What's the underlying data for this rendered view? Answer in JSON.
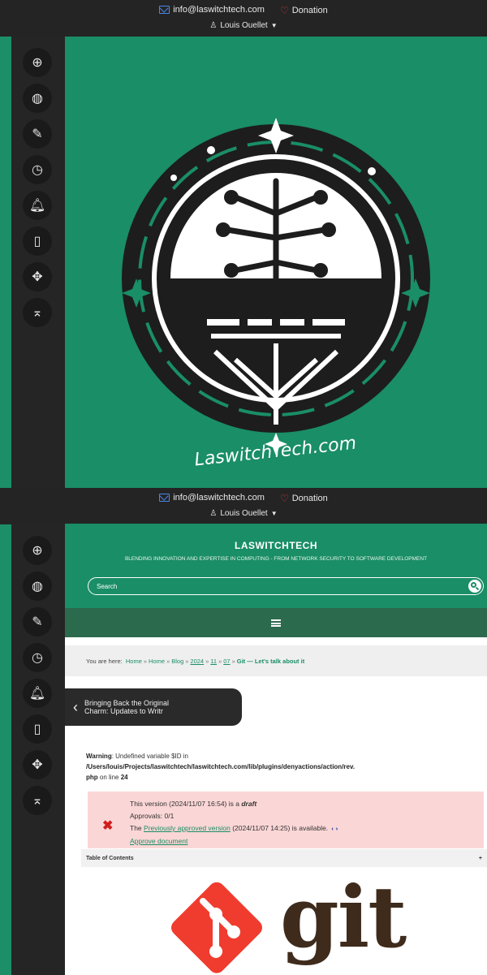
{
  "topbar": {
    "email": "info@laswitchtech.com",
    "donation": "Donation",
    "user": "Louis Ouellet"
  },
  "sidebar": {
    "buttons": [
      {
        "icon": "add-icon",
        "glyph": "⊕"
      },
      {
        "icon": "globe-icon",
        "glyph": "◍"
      },
      {
        "icon": "edit-icon",
        "glyph": "✎"
      },
      {
        "icon": "history-icon",
        "glyph": "◷"
      },
      {
        "icon": "bell-icon",
        "glyph": "♫"
      },
      {
        "icon": "pdf-icon",
        "glyph": "▯"
      },
      {
        "icon": "move-icon",
        "glyph": "✥"
      },
      {
        "icon": "back-to-top-icon",
        "glyph": "⌅"
      }
    ]
  },
  "logo": {
    "text": "LaswitchTech.com"
  },
  "site": {
    "title": "LASWITCHTECH",
    "tagline": "BLENDING INNOVATION AND EXPERTISE IN COMPUTING - FROM NETWORK SECURITY TO SOFTWARE DEVELOPMENT",
    "search_placeholder": "Search"
  },
  "breadcrumb": {
    "prefix": "You are here:",
    "items": [
      "Home",
      "Home",
      "Blog",
      "2024",
      "11",
      "07"
    ],
    "current": "Git — Let's talk about it"
  },
  "prev_page": {
    "label_line1": "Bringing Back the Original",
    "label_line2": "Charm: Updates to Writr"
  },
  "warning": {
    "label": "Warning",
    "message": ": Undefined variable $ID in",
    "path": "/Users/louis/Projects/laswitchtech/laswitchtech.com/lib/plugins/denyactions/action/rev.",
    "path_end": "php",
    "on_line": "on line",
    "line": "24"
  },
  "notice": {
    "line1_pre": "This version (2024/11/07 16:54) is a",
    "line1_bold": "draft",
    "line2": "Approvals: 0/1",
    "line3_pre": "The",
    "line3_link": "Previously approved version",
    "line3_post": "(2024/11/07 14:25) is available.",
    "line4_link": "Approve document"
  },
  "toc": {
    "label": "Table of Contents",
    "toggle": "+"
  },
  "git": {
    "word": "git",
    "color": "#f03c2e"
  },
  "colors": {
    "brand_green": "#1a8e66",
    "dark": "#252525"
  }
}
